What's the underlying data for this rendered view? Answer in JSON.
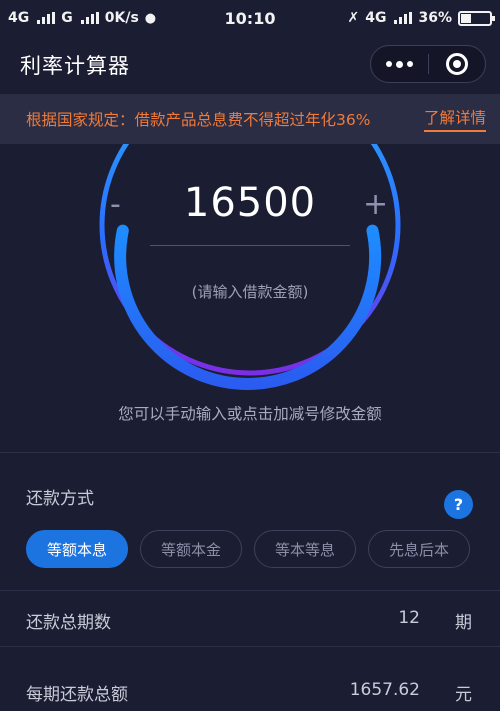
{
  "status_bar": {
    "network1": "4G",
    "network2": "G",
    "speed": "0K/s",
    "time": "10:10",
    "network3": "4G",
    "battery": "36%"
  },
  "header": {
    "title": "利率计算器"
  },
  "notice": {
    "text": "根据国家规定：借款产品总息费不得超过年化36%",
    "link": "了解详情"
  },
  "loan": {
    "minus": "-",
    "plus": "+",
    "amount": "16500",
    "hint": "(请输入借款金额)",
    "description": "您可以手动输入或点击加减号修改金额"
  },
  "repayment": {
    "label": "还款方式",
    "help": "?",
    "methods": [
      "等额本息",
      "等额本金",
      "等本等息",
      "先息后本"
    ],
    "selected": "等额本息"
  },
  "rows": [
    {
      "label": "还款总期数",
      "value": "12",
      "unit": "期"
    },
    {
      "label": "每期还款总额",
      "value": "1657.62",
      "unit": "元"
    }
  ],
  "colors": {
    "accent": "#1c74e0",
    "notice": "#f07a3a",
    "background": "#1b1d33"
  }
}
